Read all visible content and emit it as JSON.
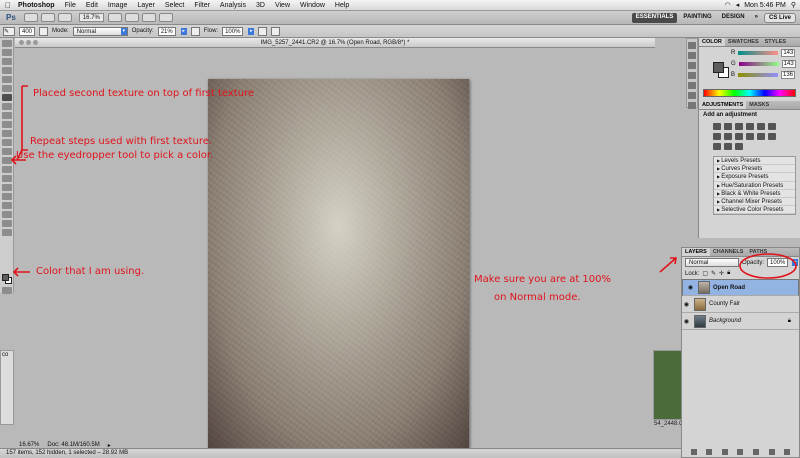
{
  "menubar": {
    "app": "Photoshop",
    "items": [
      "File",
      "Edit",
      "Image",
      "Layer",
      "Select",
      "Filter",
      "Analysis",
      "3D",
      "View",
      "Window",
      "Help"
    ],
    "clock": "Mon 5:46 PM"
  },
  "appbar": {
    "logo": "Ps",
    "zoom": "16.7%",
    "workspaces": [
      "ESSENTIALS",
      "PAINTING",
      "DESIGN"
    ],
    "cs_live": "CS Live"
  },
  "options": {
    "brush_size": "400",
    "mode_label": "Mode:",
    "mode_value": "Normal",
    "opacity_label": "Opacity:",
    "opacity_value": "21%",
    "flow_label": "Flow:",
    "flow_value": "100%"
  },
  "document": {
    "title": "IMG_5257_2441.CR2 @ 16.7% (Open Road, RGB/8*) *",
    "zoom": "16.67%",
    "doc_size": "Doc: 48.1M/160.5M"
  },
  "finder_status": "157 items, 152 hidden, 1 selected – 28.92 MB",
  "color_panel": {
    "tabs": [
      "COLOR",
      "SWATCHES",
      "STYLES"
    ],
    "r": {
      "label": "R",
      "value": "143"
    },
    "g": {
      "label": "G",
      "value": "143"
    },
    "b": {
      "label": "B",
      "value": "136"
    }
  },
  "adjustments_panel": {
    "tabs": [
      "ADJUSTMENTS",
      "MASKS"
    ],
    "heading": "Add an adjustment",
    "presets": [
      "Levels Presets",
      "Curves Presets",
      "Exposure Presets",
      "Hue/Saturation Presets",
      "Black & White Presets",
      "Channel Mixer Presets",
      "Selective Color Presets"
    ]
  },
  "layers_panel": {
    "tabs": [
      "LAYERS",
      "CHANNELS",
      "PATHS"
    ],
    "blend_mode": "Normal",
    "opacity_label": "Opacity:",
    "opacity_value": "100%",
    "lock_label": "Lock:",
    "layers": [
      {
        "name": "Open Road"
      },
      {
        "name": "County Fair"
      },
      {
        "name": "Background"
      }
    ]
  },
  "peek_right_label": "54_2448.CR",
  "peek_left_label": "co",
  "annotations": {
    "a1": "Placed second texture on top of first texture",
    "a2": "Repeat steps used with first texture.",
    "a3": "Use the eyedropper tool to pick a color.",
    "a4": "Color that I am using.",
    "a5": "Make sure you are at 100%",
    "a6": "on Normal mode."
  },
  "colors": {
    "annotation": "#e0131b",
    "selected_layer": "#93b4e3",
    "foreground": "#5d5d5d"
  }
}
